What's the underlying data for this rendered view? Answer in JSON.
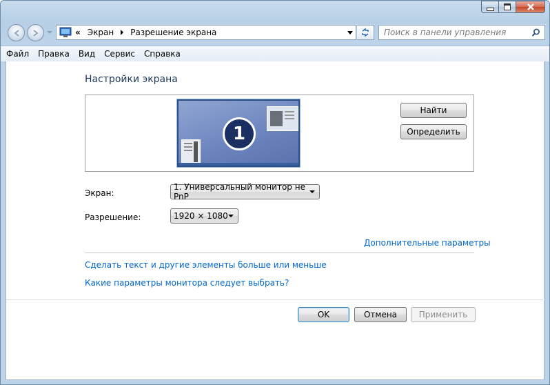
{
  "window": {
    "caption_buttons": {
      "minimize": "minimize-icon",
      "maximize": "maximize-icon",
      "close": "close-icon"
    }
  },
  "address_bar": {
    "breadcrumb_overflow": "«",
    "crumbs": [
      "Экран",
      "Разрешение экрана"
    ],
    "search_placeholder": "Поиск в панели управления"
  },
  "menu": {
    "items": [
      "Файл",
      "Правка",
      "Вид",
      "Сервис",
      "Справка"
    ]
  },
  "main": {
    "title": "Настройки экрана",
    "monitor_number": "1",
    "detect_button": "Найти",
    "identify_button": "Определить",
    "display_label": "Экран:",
    "display_value": "1. Универсальный монитор не PnP",
    "resolution_label": "Разрешение:",
    "resolution_value": "1920 × 1080",
    "advanced_link": "Дополнительные параметры",
    "text_size_link": "Сделать текст и другие элементы больше или меньше",
    "which_settings_link": "Какие параметры монитора следует выбрать?"
  },
  "footer": {
    "ok": "OK",
    "cancel": "Отмена",
    "apply": "Применить"
  },
  "colors": {
    "link": "#0066cc",
    "title": "#1e395b",
    "monitor_fill": "#6b83bd"
  }
}
